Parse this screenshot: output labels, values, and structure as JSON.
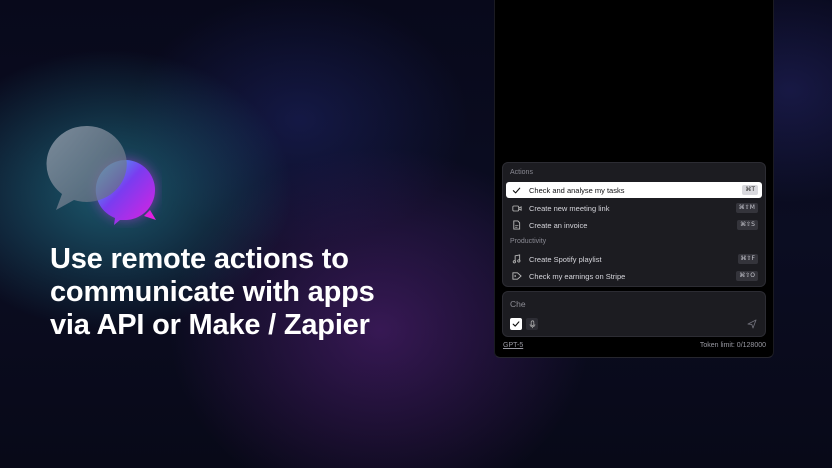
{
  "headline": {
    "line1": "Use remote actions to",
    "line2": "communicate with apps",
    "line3": "via API or Make / Zapier"
  },
  "menu": {
    "sections": [
      {
        "label": "Actions",
        "items": [
          {
            "label": "Check and analyse my tasks",
            "shortcut": "⌘T",
            "icon": "check-icon",
            "active": true
          },
          {
            "label": "Create new meeting link",
            "shortcut": "⌘⇧M",
            "icon": "video-icon",
            "active": false
          },
          {
            "label": "Create an invoice",
            "shortcut": "⌘⇧S",
            "icon": "document-icon",
            "active": false
          }
        ]
      },
      {
        "label": "Productivity",
        "items": [
          {
            "label": "Create Spotify playlist",
            "shortcut": "⌘⇧F",
            "icon": "music-icon",
            "active": false
          },
          {
            "label": "Check my earnings on Stripe",
            "shortcut": "⌘⇧O",
            "icon": "tag-icon",
            "active": false
          }
        ]
      }
    ]
  },
  "composer": {
    "input_value": "Che",
    "model": "GPT-5",
    "token_limit": "Token limit: 0/128000"
  },
  "colors": {
    "accent_magenta": "#e020e0",
    "accent_purple": "#7a3cf0",
    "panel_bg": "#000000",
    "menu_bg": "#1c1c21",
    "active_row": "#ffffff"
  }
}
